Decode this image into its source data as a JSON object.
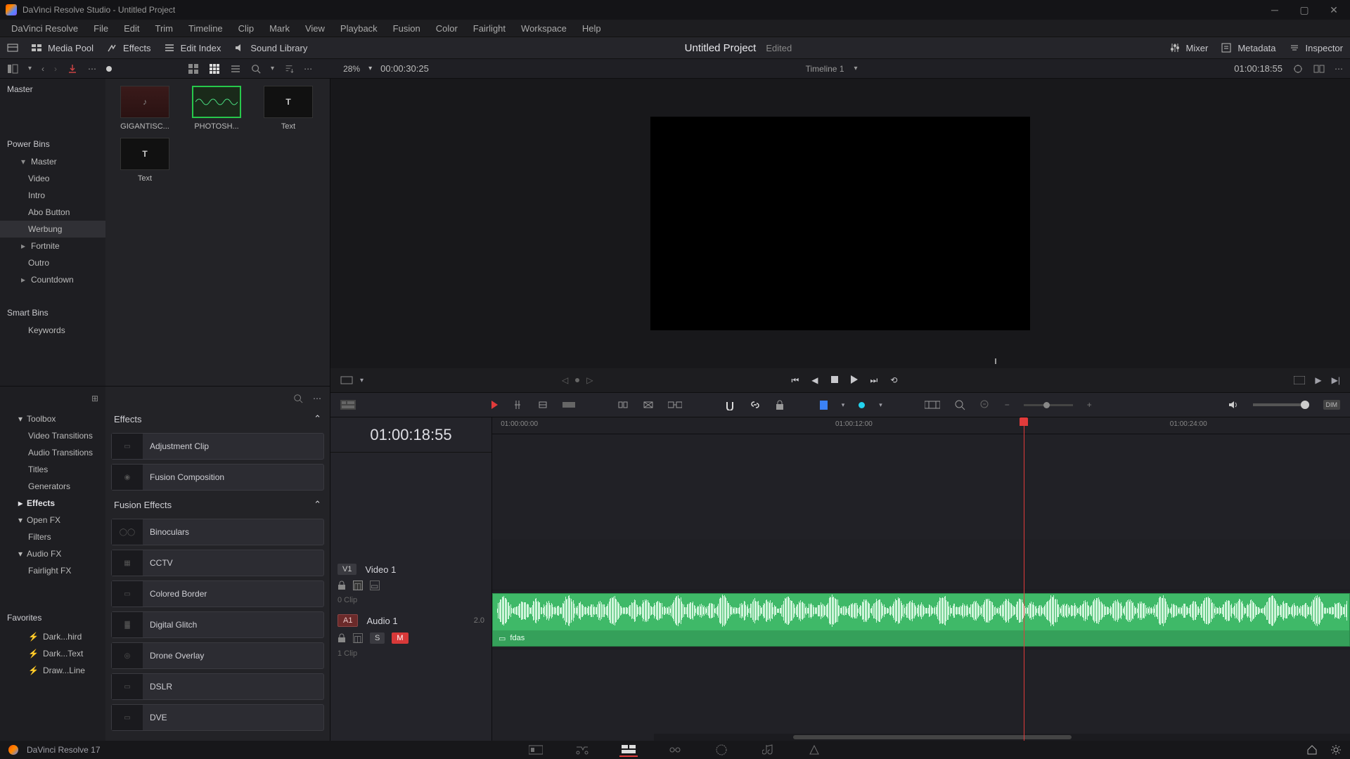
{
  "titlebar": {
    "text": "DaVinci Resolve Studio - Untitled Project"
  },
  "menubar": [
    "DaVinci Resolve",
    "File",
    "Edit",
    "Trim",
    "Timeline",
    "Clip",
    "Mark",
    "View",
    "Playback",
    "Fusion",
    "Color",
    "Fairlight",
    "Workspace",
    "Help"
  ],
  "topbar": {
    "left": [
      {
        "label": "Media Pool",
        "icon": "media-pool-icon"
      },
      {
        "label": "Effects",
        "icon": "effects-icon"
      },
      {
        "label": "Edit Index",
        "icon": "edit-index-icon"
      },
      {
        "label": "Sound Library",
        "icon": "sound-library-icon"
      }
    ],
    "title": "Untitled Project",
    "edited": "Edited",
    "right": [
      {
        "label": "Mixer",
        "icon": "mixer-icon"
      },
      {
        "label": "Metadata",
        "icon": "metadata-icon"
      },
      {
        "label": "Inspector",
        "icon": "inspector-icon"
      }
    ]
  },
  "subtop": {
    "zoom_pct": "28%",
    "duration": "00:00:30:25",
    "timeline_name": "Timeline 1",
    "right_tc": "01:00:18:55"
  },
  "bins": {
    "master": "Master",
    "power": "Power Bins",
    "tree": [
      {
        "label": "Master",
        "expanded": true,
        "children": [
          {
            "label": "Video"
          },
          {
            "label": "Intro"
          },
          {
            "label": "Abo Button"
          },
          {
            "label": "Werbung",
            "selected": true
          }
        ]
      },
      {
        "label": "Fortnite",
        "expanded": false,
        "children": []
      },
      {
        "label": "Outro"
      },
      {
        "label": "Countdown",
        "expanded": false
      }
    ],
    "smart": "Smart Bins",
    "smart_items": [
      "Keywords"
    ]
  },
  "clips": [
    {
      "name": "GIGANTISC...",
      "type": "audio"
    },
    {
      "name": "PHOTOSH...",
      "type": "green"
    },
    {
      "name": "Text",
      "type": "text"
    },
    {
      "name": "Text",
      "type": "text"
    }
  ],
  "fx_tree": [
    {
      "label": "Toolbox",
      "expanded": true,
      "children": [
        {
          "label": "Video Transitions"
        },
        {
          "label": "Audio Transitions"
        },
        {
          "label": "Titles"
        },
        {
          "label": "Generators"
        },
        {
          "label": "Effects",
          "selected": true
        }
      ]
    },
    {
      "label": "Open FX",
      "expanded": true,
      "children": [
        {
          "label": "Filters"
        }
      ]
    },
    {
      "label": "Audio FX",
      "expanded": true,
      "children": [
        {
          "label": "Fairlight FX"
        }
      ]
    }
  ],
  "fx_fav_h": "Favorites",
  "fx_favs": [
    "Dark...hird",
    "Dark...Text",
    "Draw...Line"
  ],
  "fx_cats": [
    {
      "name": "Effects",
      "items": [
        "Adjustment Clip",
        "Fusion Composition"
      ]
    },
    {
      "name": "Fusion Effects",
      "items": [
        "Binoculars",
        "CCTV",
        "Colored Border",
        "Digital Glitch",
        "Drone Overlay",
        "DSLR",
        "DVE"
      ]
    }
  ],
  "timeline": {
    "tc": "01:00:18:55",
    "ruler": [
      "01:00:00:00",
      "01:00:12:00",
      "01:00:24:00"
    ],
    "video_track": {
      "code": "V1",
      "name": "Video 1",
      "clips": "0 Clip"
    },
    "audio_track": {
      "code": "A1",
      "name": "Audio 1",
      "ch": "2.0",
      "clips": "1 Clip",
      "clip_name": "fdas"
    }
  },
  "bottombar": {
    "version": "DaVinci Resolve 17"
  }
}
